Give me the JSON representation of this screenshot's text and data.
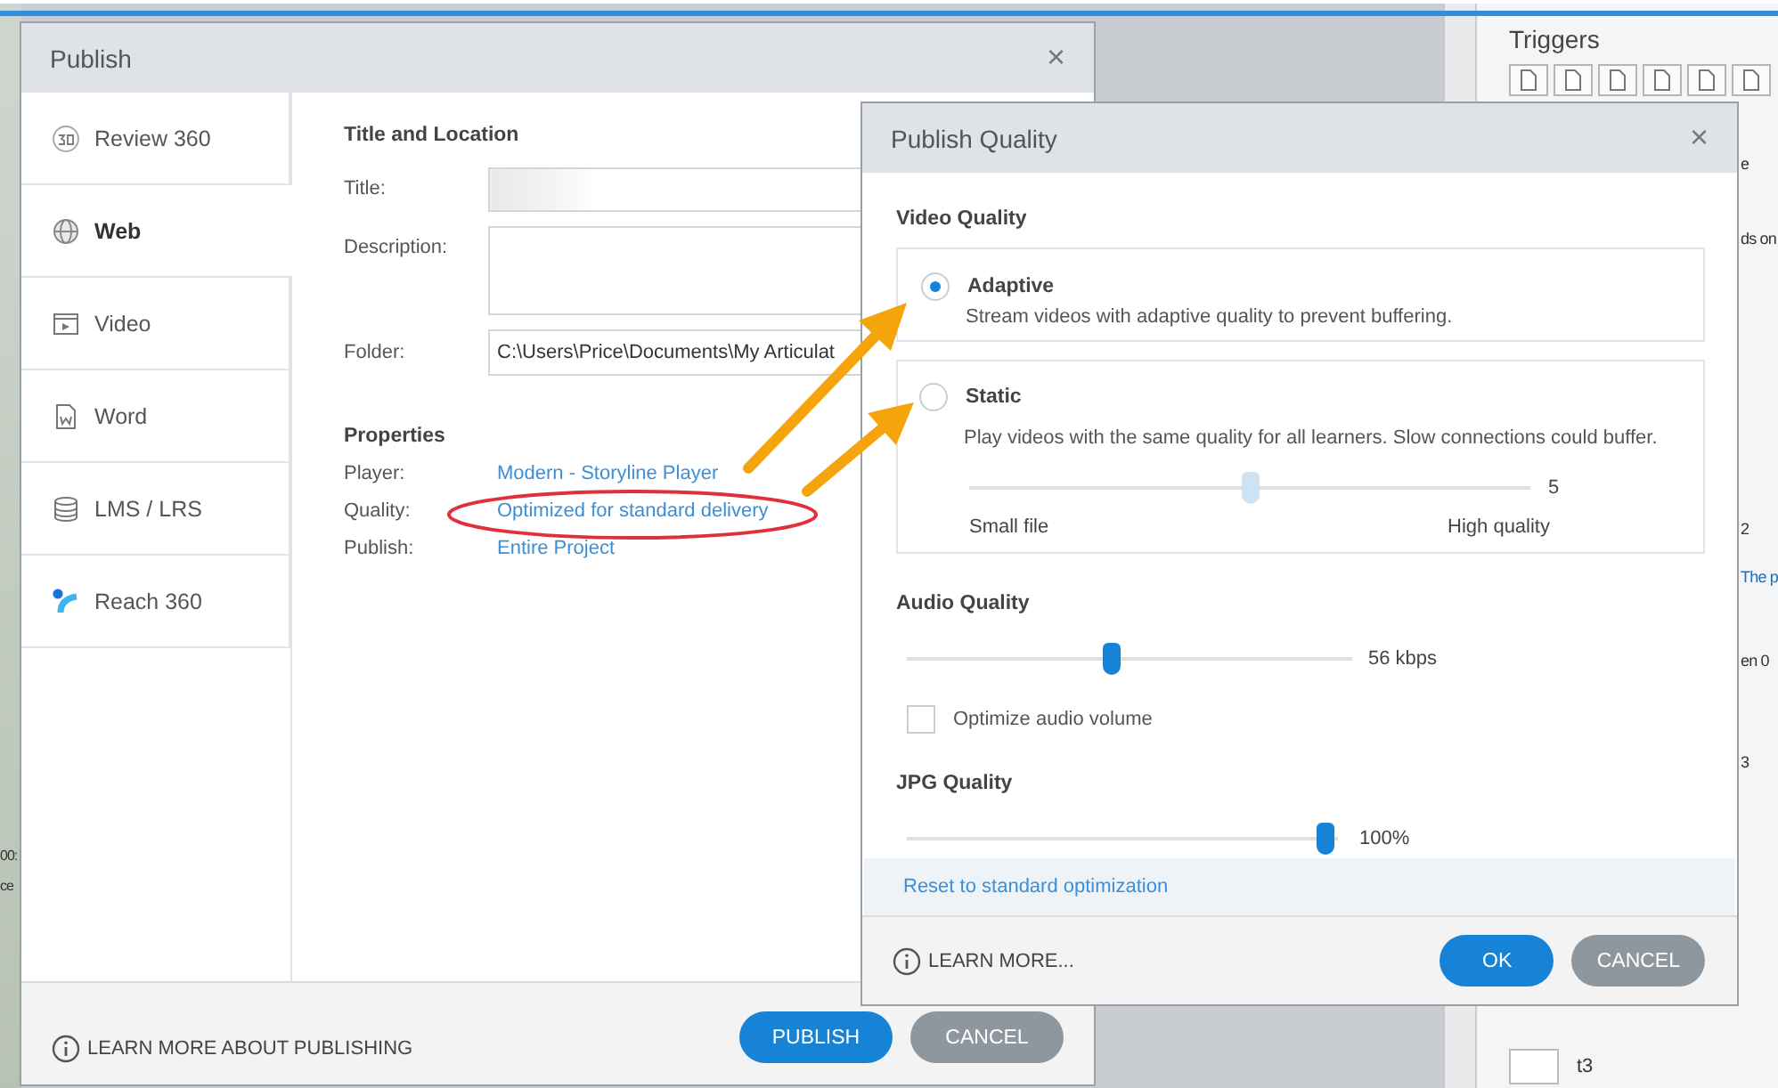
{
  "app": {
    "left_fragments": [
      "00:",
      "ce"
    ],
    "triggers_panel": {
      "title": "Triggers",
      "fragments": [
        "e",
        "ds on",
        "2",
        "The p",
        "en 0",
        "3"
      ],
      "slide_label": "t3"
    }
  },
  "publish_dialog": {
    "title": "Publish",
    "close": "×",
    "tabs": [
      {
        "label": "Review 360",
        "kind": "review",
        "selected": false
      },
      {
        "label": "Web",
        "kind": "web",
        "selected": true
      },
      {
        "label": "Video",
        "kind": "video",
        "selected": false
      },
      {
        "label": "Word",
        "kind": "word",
        "selected": false
      },
      {
        "label": "LMS / LRS",
        "kind": "lms",
        "selected": false
      },
      {
        "label": "Reach 360",
        "kind": "reach",
        "selected": false
      }
    ],
    "section_title": "Title and Location",
    "fields": [
      {
        "label": "Title:",
        "kind": "blurred"
      },
      {
        "label": "Description:",
        "kind": "area"
      },
      {
        "label": "Folder:",
        "kind": "line",
        "value": "C:\\Users\\Price\\Documents\\My Articulat"
      }
    ],
    "properties_title": "Properties",
    "properties": [
      {
        "label": "Player:",
        "value": "Modern - Storyline Player"
      },
      {
        "label": "Quality:",
        "value": "Optimized for standard delivery"
      },
      {
        "label": "Publish:",
        "value": "Entire Project"
      }
    ],
    "learn_more": "LEARN MORE ABOUT PUBLISHING",
    "buttons": [
      {
        "label": "PUBLISH",
        "kind": "primary"
      },
      {
        "label": "CANCEL",
        "kind": "secondary"
      }
    ]
  },
  "quality_dialog": {
    "title": "Publish Quality",
    "close": "×",
    "video_title": "Video Quality",
    "options": [
      {
        "label": "Adaptive",
        "description": "Stream videos with adaptive quality to prevent buffering.",
        "selected": true
      },
      {
        "label": "Static",
        "description": "Play videos with the same quality for all learners. Slow connections could buffer.",
        "selected": false,
        "slider": {
          "level": 0.5,
          "reading": "5",
          "min_label": "Small file",
          "max_label": "High quality",
          "disabled": true
        }
      }
    ],
    "audio_title": "Audio Quality",
    "audio_slider": {
      "level": 0.46,
      "reading": "56 kbps"
    },
    "audio_checkbox": {
      "label": "Optimize audio volume",
      "checked": false
    },
    "jpg_title": "JPG Quality",
    "jpg_slider": {
      "level": 0.97,
      "reading": "100%"
    },
    "reset_link": "Reset to standard optimization",
    "learn_more": "LEARN MORE...",
    "buttons": [
      {
        "label": "OK",
        "kind": "primary"
      },
      {
        "label": "CANCEL",
        "kind": "secondary"
      }
    ]
  }
}
